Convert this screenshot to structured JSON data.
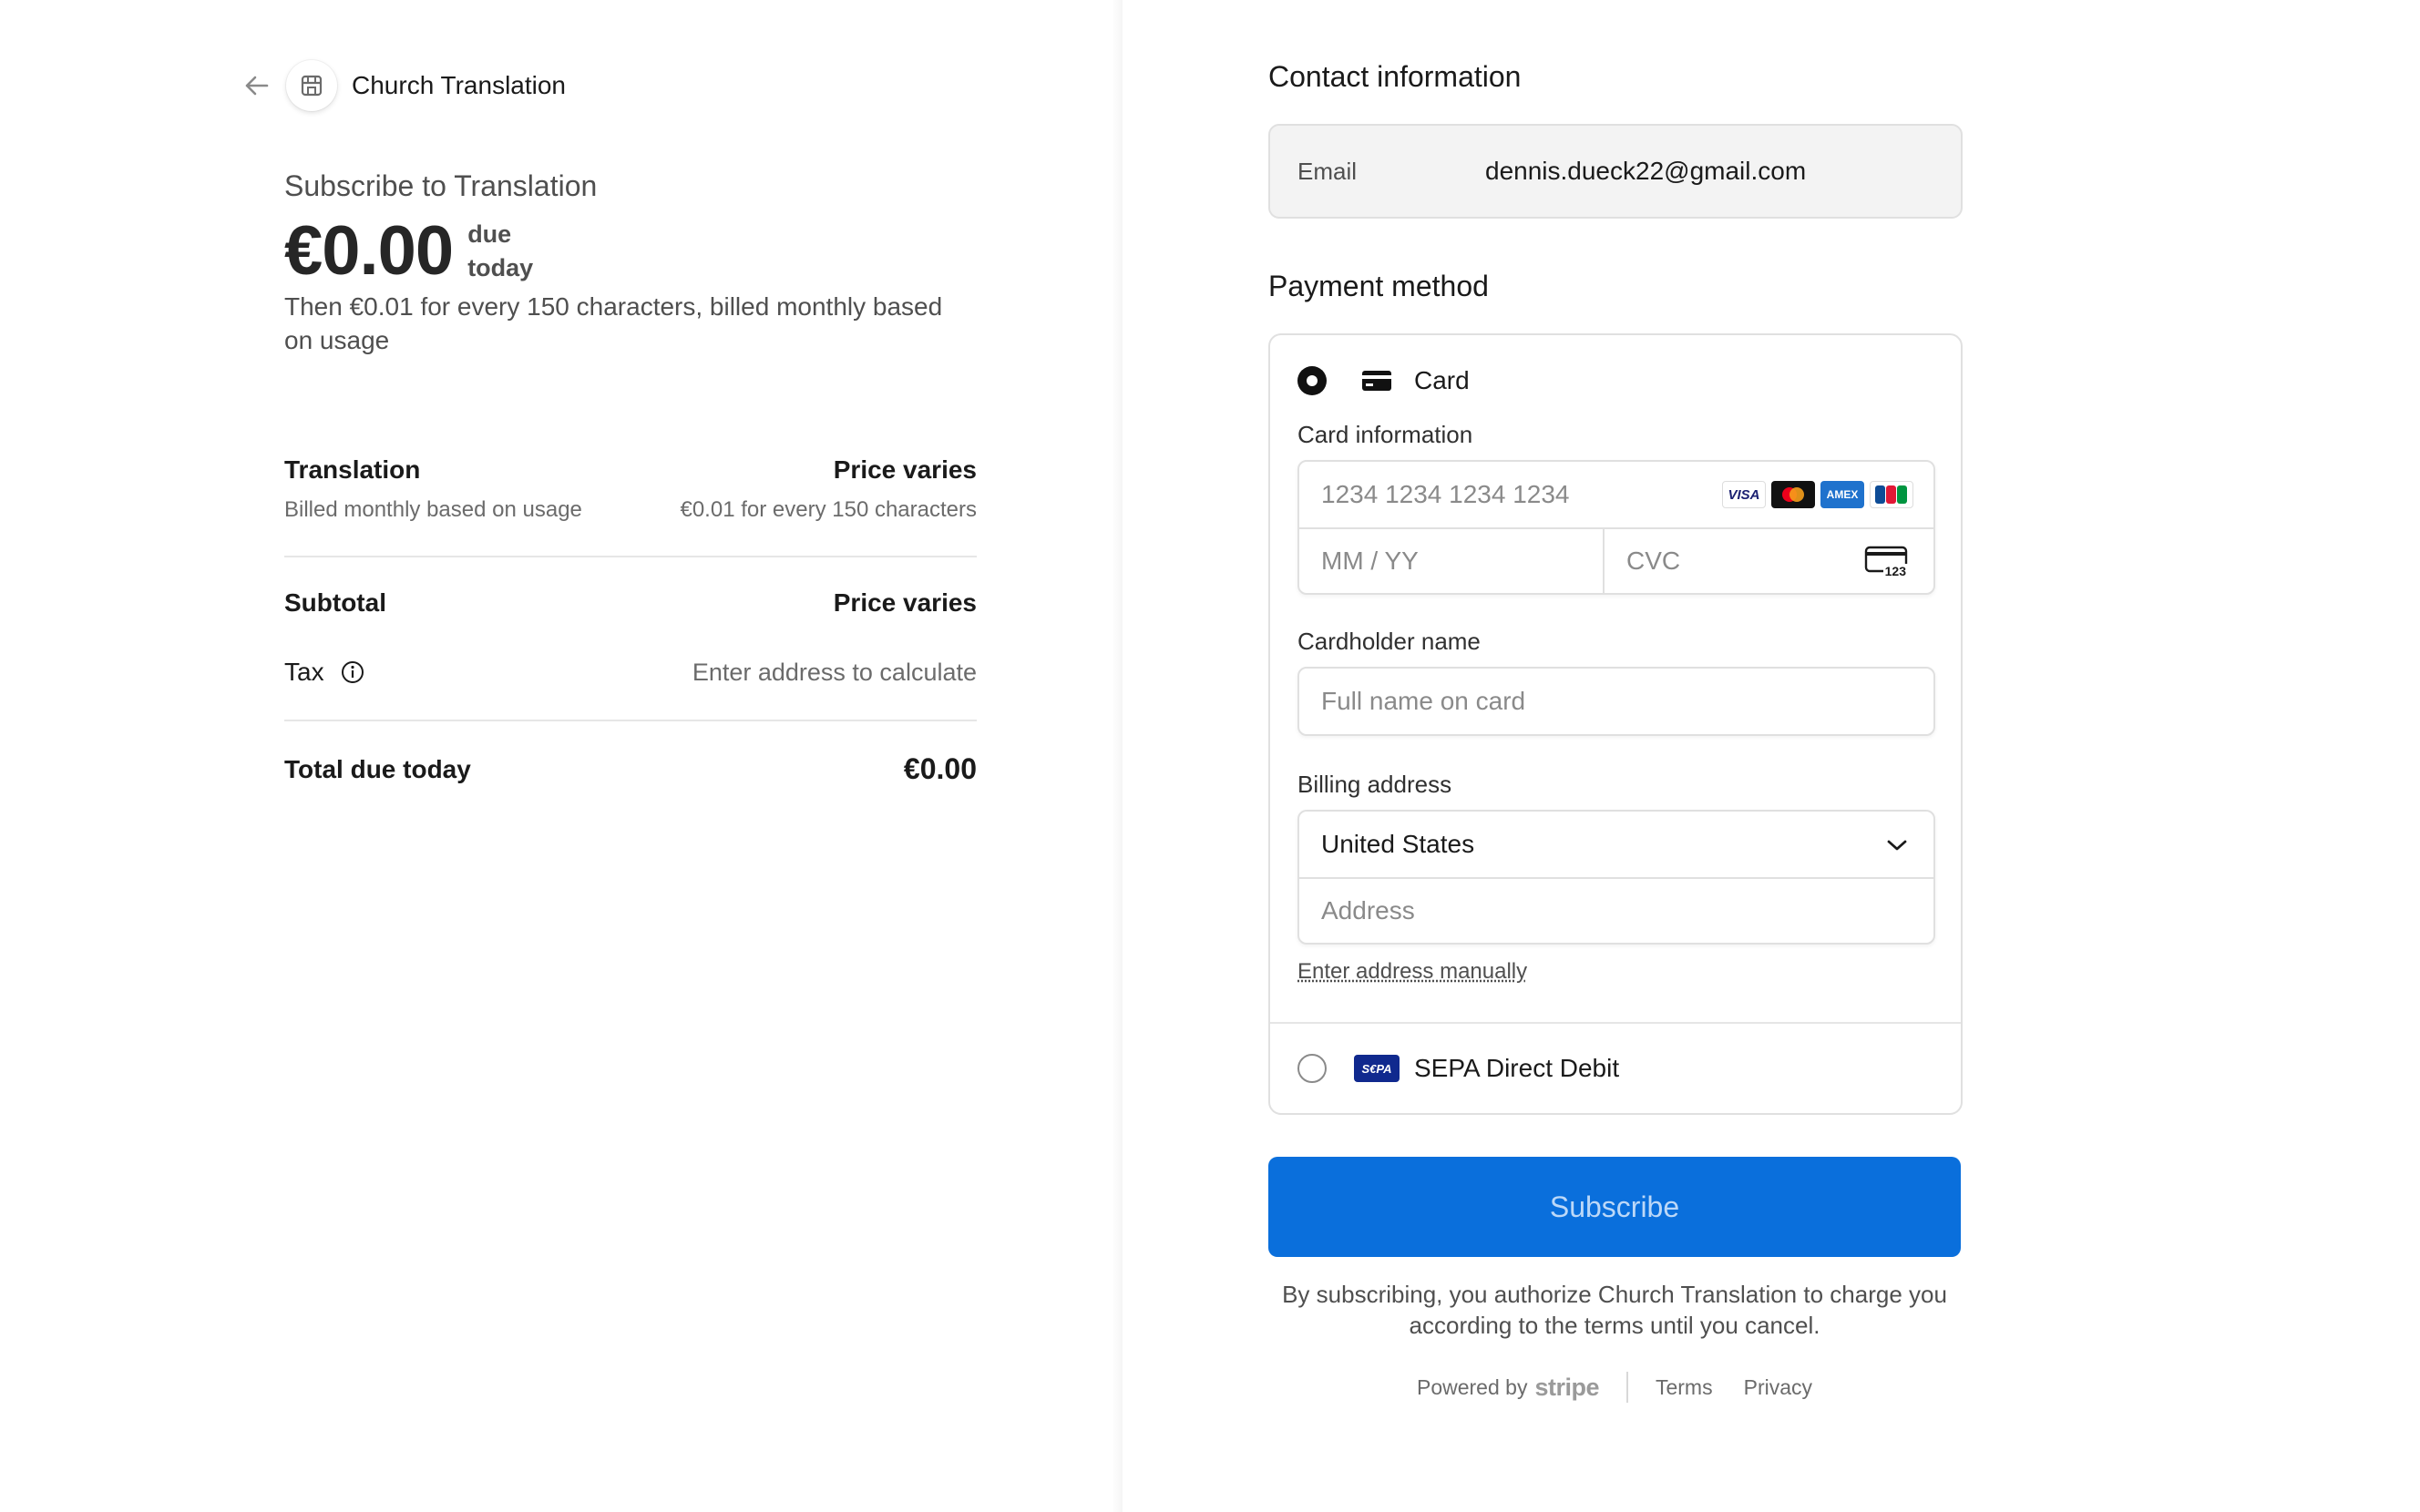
{
  "merchant": {
    "name": "Church Translation"
  },
  "summary": {
    "product_title": "Subscribe to Translation",
    "price": "€0.00",
    "due_line1": "due",
    "due_line2": "today",
    "price_description": "Then €0.01 for every 150 characters, billed monthly based on usage",
    "line_item": {
      "name": "Translation",
      "price": "Price varies",
      "billing": "Billed monthly based on usage",
      "rate": "€0.01 for every 150 characters"
    },
    "subtotal_label": "Subtotal",
    "subtotal_value": "Price varies",
    "tax_label": "Tax",
    "tax_value": "Enter address to calculate",
    "total_label": "Total due today",
    "total_value": "€0.00"
  },
  "contact": {
    "title": "Contact information",
    "email_label": "Email",
    "email_value": "dennis.dueck22@gmail.com"
  },
  "payment": {
    "title": "Payment method",
    "card_label": "Card",
    "card_selected": true,
    "card_info_label": "Card information",
    "card_number_placeholder": "1234 1234 1234 1234",
    "expiry_placeholder": "MM / YY",
    "cvc_placeholder": "CVC",
    "cvc_icon_text": "123",
    "brands": [
      "VISA",
      "Mastercard",
      "AMEX",
      "JCB"
    ],
    "cardholder_label": "Cardholder name",
    "cardholder_placeholder": "Full name on card",
    "billing_label": "Billing address",
    "country": "United States",
    "address_placeholder": "Address",
    "manual_link": "Enter address manually",
    "sepa_label": "SEPA Direct Debit",
    "sepa_badge": "S€PA"
  },
  "actions": {
    "subscribe": "Subscribe"
  },
  "legal": "By subscribing, you authorize Church Translation to charge you according to the terms until you cancel.",
  "footer": {
    "powered_by": "Powered by",
    "stripe": "stripe",
    "terms": "Terms",
    "privacy": "Privacy"
  },
  "colors": {
    "primary": "#0a6fdc",
    "button_text": "#bcd8f8",
    "border": "#e0e0e0"
  }
}
